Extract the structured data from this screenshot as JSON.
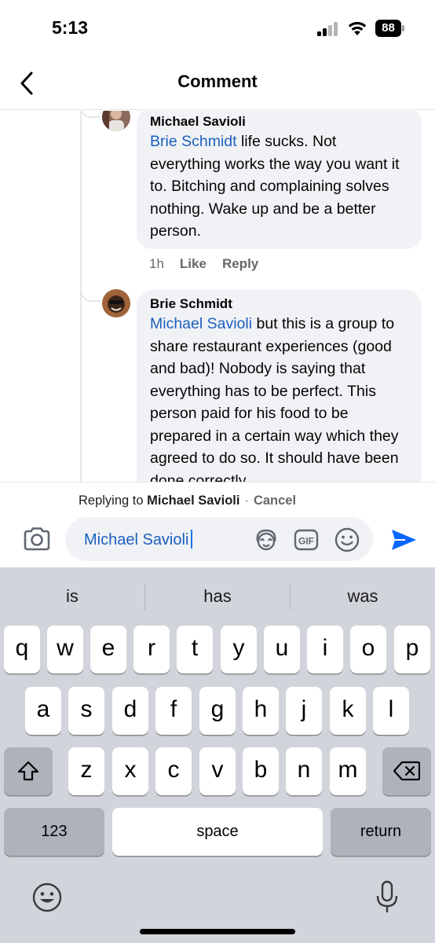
{
  "status_bar": {
    "time": "5:13",
    "battery": "88"
  },
  "header": {
    "title": "Comment"
  },
  "comments": [
    {
      "author": "Michael Savioli",
      "mention": "Brie Schmidt",
      "text": " life sucks. Not everything works the way you want it to. Bitching and complaining solves nothing. Wake up and be a better person.",
      "time": "1h",
      "like_label": "Like",
      "reply_label": "Reply"
    },
    {
      "author": "Brie Schmidt",
      "mention": "Michael Savioli",
      "text": " but this is a group to share restaurant experiences (good and bad)! Nobody is saying that everything has to be perfect. This person paid for his food to be prepared in a certain way which they agreed to do so. It should have been done correctly."
    }
  ],
  "reply_bar": {
    "prefix": "Replying to",
    "name": "Michael Savioli",
    "separator": "·",
    "cancel": "Cancel"
  },
  "composer": {
    "value": "Michael Savioli",
    "icons": [
      "camera-icon",
      "avatar-sticker-icon",
      "gif-icon",
      "emoji-icon",
      "send-icon"
    ],
    "send_color": "#0866ff"
  },
  "keyboard": {
    "suggestions": [
      "is",
      "has",
      "was"
    ],
    "row1": [
      "q",
      "w",
      "e",
      "r",
      "t",
      "y",
      "u",
      "i",
      "o",
      "p"
    ],
    "row2": [
      "a",
      "s",
      "d",
      "f",
      "g",
      "h",
      "j",
      "k",
      "l"
    ],
    "row3": [
      "z",
      "x",
      "c",
      "v",
      "b",
      "n",
      "m"
    ],
    "numbers_label": "123",
    "space_label": "space",
    "return_label": "return"
  },
  "colors": {
    "mention": "#1d5fbf",
    "bubble": "#f0f2f5",
    "keyboard_bg": "#d1d4da"
  }
}
